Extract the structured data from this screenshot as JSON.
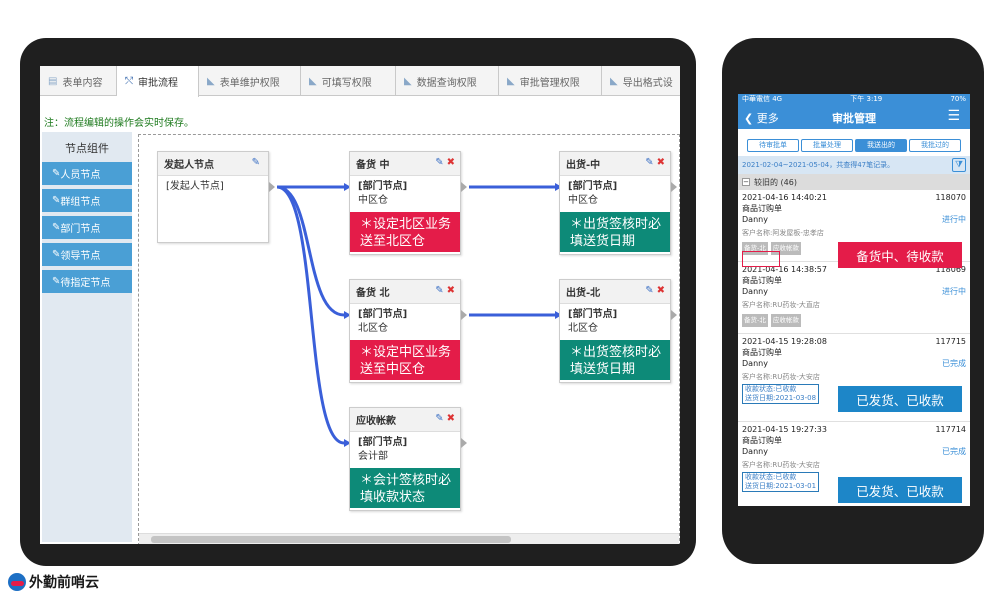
{
  "tabs": [
    {
      "label": "表单内容",
      "icon": "document-icon"
    },
    {
      "label": "审批流程",
      "icon": "flow-icon"
    },
    {
      "label": "表单维护权限",
      "icon": "rss-icon"
    },
    {
      "label": "可填写权限",
      "icon": "rss-icon"
    },
    {
      "label": "数据查询权限",
      "icon": "rss-icon"
    },
    {
      "label": "审批管理权限",
      "icon": "rss-icon"
    },
    {
      "label": "导出格式设",
      "icon": "rss-icon"
    }
  ],
  "note": "注：流程编辑的操作会实时保存。",
  "sidebar": {
    "title": "节点组件",
    "items": [
      "人员节点",
      "群组节点",
      "部门节点",
      "领导节点",
      "待指定节点"
    ]
  },
  "nodes": {
    "start": {
      "title": "发起人节点",
      "body": "[发起人节点]"
    },
    "prep_mid": {
      "title": "备货 中",
      "type": "[部门节点]",
      "dept": "中区仓",
      "warn": "＊设定北区业务送至北区仓"
    },
    "ship_mid": {
      "title": "出货-中",
      "type": "[部门节点]",
      "dept": "中区仓",
      "warn": "＊出货签核时必填送货日期"
    },
    "prep_north": {
      "title": "备货 北",
      "type": "[部门节点]",
      "dept": "北区仓",
      "warn": "＊设定中区业务送至中区仓"
    },
    "ship_north": {
      "title": "出货-北",
      "type": "[部门节点]",
      "dept": "北区仓",
      "warn": "＊出货签核时必填送货日期"
    },
    "ar": {
      "title": "应收帐款",
      "type": "[部门节点]",
      "dept": "会计部",
      "warn": "＊会计签核时必填收款状态"
    }
  },
  "phone": {
    "status_left": "中華電信 4G",
    "status_time": "下午 3:19",
    "status_right": "70%",
    "back": "更多",
    "title": "审批管理",
    "segments": [
      "待审批单",
      "批量处理",
      "我送出的",
      "我批过的"
    ],
    "active_segment": 2,
    "range": "2021-02-04~2021-05-04，共查得47笔记录。",
    "group": "较旧的 (46)",
    "records": [
      {
        "time": "2021-04-16 14:40:21",
        "num": "118070",
        "form": "商品订购单",
        "user": "Danny",
        "status": "进行中",
        "cust": "客户名称:阿发屋板-忠孝店",
        "tags": [
          "备货-北",
          "应收帐款"
        ]
      },
      {
        "time": "2021-04-16 14:38:57",
        "num": "118069",
        "form": "商品订购单",
        "user": "Danny",
        "status": "进行中",
        "cust": "客户名称:RU药妆-大直店",
        "tags": [
          "备货-北",
          "应收帐款"
        ]
      },
      {
        "time": "2021-04-15 19:28:08",
        "num": "117715",
        "form": "商品订购单",
        "user": "Danny",
        "status": "已完成",
        "cust": "客户名称:RU药妆-大安店",
        "info": [
          "收款状态:已收款",
          "送货日期:2021-03-08"
        ]
      },
      {
        "time": "2021-04-15 19:27:33",
        "num": "117714",
        "form": "商品订购单",
        "user": "Danny",
        "status": "已完成",
        "cust": "客户名称:RU药妆-大安店",
        "info": [
          "收款状态:已收款",
          "送货日期:2021-03-01"
        ]
      }
    ],
    "annotations": [
      "备货中、待收款",
      "已发货、已收款",
      "已发货、已收款"
    ]
  },
  "brand": "外勤前哨云",
  "colors": {
    "accent": "#3b8fd7",
    "warn_red": "#e41c49",
    "warn_green": "#0d8a78",
    "edge": "#3a5fd9"
  }
}
